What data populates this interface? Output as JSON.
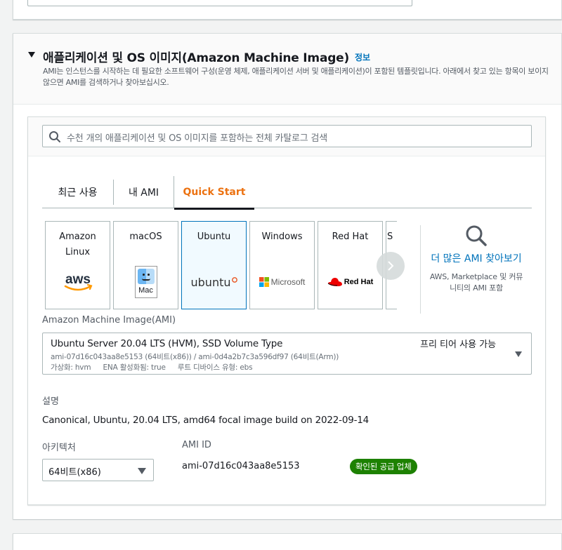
{
  "section": {
    "title": "애플리케이션 및 OS 이미지(Amazon Machine Image)",
    "info_link": "정보",
    "description": "AMI는 인스턴스를 시작하는 데 필요한 소프트웨어 구성(운영 체제, 애플리케이션 서버 및 애플리케이션)이 포함된 템플릿입니다. 아래에서 찾고 있는 항목이 보이지 않으면 AMI를 검색하거나 찾아보십시오."
  },
  "search": {
    "placeholder": "수천 개의 애플리케이션 및 OS 이미지를 포함하는 전체 카탈로그 검색"
  },
  "tabs": [
    {
      "label": "최근 사용"
    },
    {
      "label": "내 AMI"
    },
    {
      "label": "Quick Start",
      "selected": true
    }
  ],
  "os_tiles": [
    {
      "label": "Amazon Linux",
      "logo": "aws-logo",
      "logo_text": "aws"
    },
    {
      "label": "macOS",
      "logo": "mac-finder-logo",
      "logo_text": "Mac"
    },
    {
      "label": "Ubuntu",
      "logo": "ubuntu-logo",
      "logo_text": "ubuntu",
      "selected": true
    },
    {
      "label": "Windows",
      "logo": "microsoft-logo",
      "logo_text": "Microsoft"
    },
    {
      "label": "Red Hat",
      "logo": "redhat-logo",
      "logo_text": "Red Hat"
    },
    {
      "label": "S",
      "partial": true
    }
  ],
  "more": {
    "icon": "search-icon",
    "link": "더 많은 AMI 찾아보기",
    "sub": "AWS, Marketplace 및 커뮤니티의 AMI 포함"
  },
  "ami": {
    "label": "Amazon Machine Image(AMI)",
    "name": "Ubuntu Server 20.04 LTS (HVM), SSD Volume Type",
    "ids": "ami-07d16c043aa8e5153 (64비트(x86)) / ami-0d4a2b7c3a596df97 (64비트(Arm))",
    "virtualization": "가상화: hvm",
    "ena": "ENA 활성화됨: true",
    "root_device": "루트 디바이스 유형: ebs",
    "free_tier": "프리 티어 사용 가능"
  },
  "details": {
    "description_label": "설명",
    "description": "Canonical, Ubuntu, 20.04 LTS, amd64 focal image build on 2022-09-14",
    "architecture_label": "아키텍처",
    "architecture_value": "64비트(x86)",
    "ami_id_label": "AMI ID",
    "ami_id": "ami-07d16c043aa8e5153",
    "verified_badge": "확인된 공급 업체"
  },
  "colors": {
    "link": "#0073bb",
    "selected_tab": "#ec7211",
    "badge": "#1d8102",
    "selected_tile_bg": "#f1faff"
  }
}
